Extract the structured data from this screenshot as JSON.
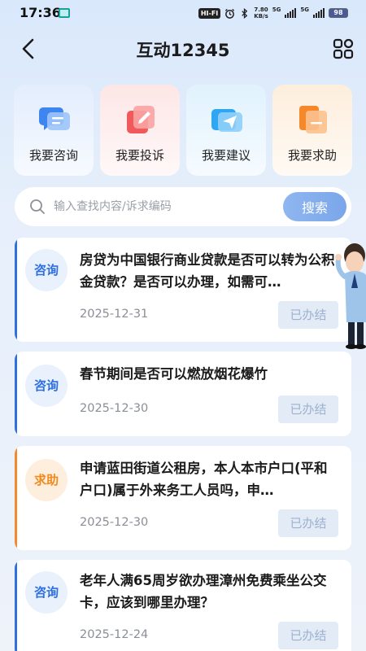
{
  "status_bar": {
    "time": "17:36",
    "hifi": "HI-FI",
    "speed_value": "7.80",
    "speed_unit": "KB/s",
    "network1": "5G",
    "network2": "5G",
    "battery": "98"
  },
  "header": {
    "title": "互动12345",
    "back_icon": "chevron-left-icon",
    "menu_icon": "grid-icon"
  },
  "quick_actions": [
    {
      "label": "我要咨询",
      "icon": "chat-icon",
      "color": "#3d86f0"
    },
    {
      "label": "我要投诉",
      "icon": "complaint-icon",
      "color": "#f05a5a"
    },
    {
      "label": "我要建议",
      "icon": "send-icon",
      "color": "#2fa6f2"
    },
    {
      "label": "我要求助",
      "icon": "help-icon",
      "color": "#f5882a"
    }
  ],
  "search": {
    "placeholder": "输入查找内容/诉求编码",
    "button_label": "搜索"
  },
  "items": [
    {
      "type": "咨询",
      "title": "房贷为中国银行商业贷款是否可以转为公积金贷款？是否可以办理，如需可…",
      "date": "2025-12-31",
      "status": "已办结",
      "accent": "#2f6fe0"
    },
    {
      "type": "咨询",
      "title": "春节期间是否可以燃放烟花爆竹",
      "date": "2025-12-30",
      "status": "已办结",
      "accent": "#2f6fe0"
    },
    {
      "type": "求助",
      "title": "申请蓝田街道公租房，本人本市户口(平和户口)属于外来务工人员吗，申…",
      "date": "2025-12-30",
      "status": "已办结",
      "accent": "#f5882a"
    },
    {
      "type": "咨询",
      "title": "老年人满65周岁欲办理漳州免费乘坐公交卡，应该到哪里办理？",
      "date": "2025-12-24",
      "status": "已办结",
      "accent": "#2f6fe0"
    }
  ]
}
